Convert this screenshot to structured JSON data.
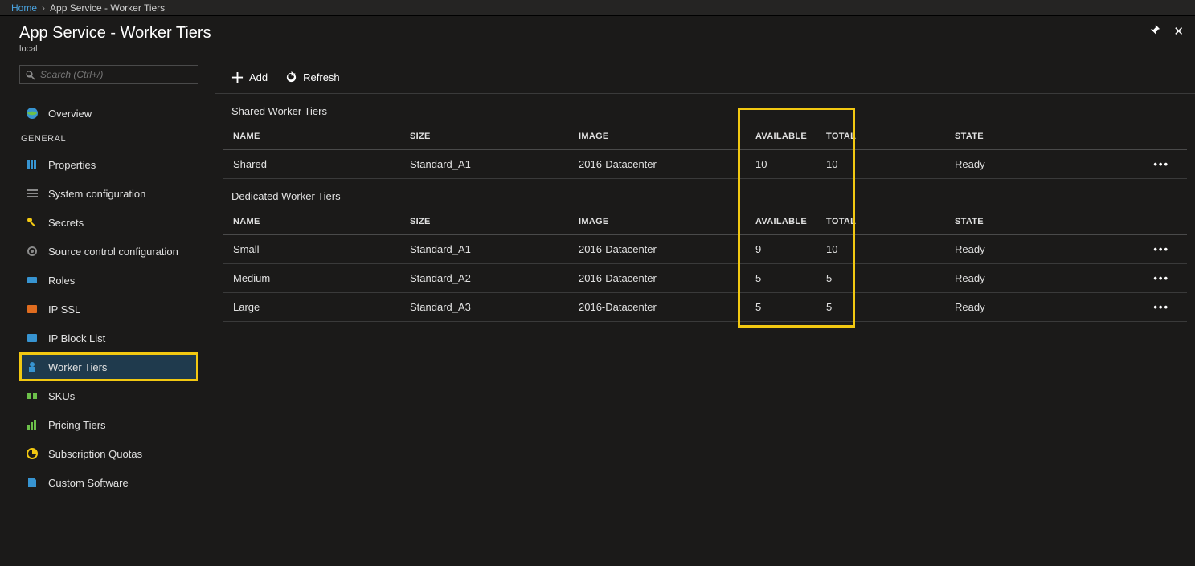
{
  "breadcrumb": {
    "home": "Home",
    "current": "App Service - Worker Tiers"
  },
  "header": {
    "title": "App Service - Worker Tiers",
    "subtitle": "local"
  },
  "search": {
    "placeholder": "Search (Ctrl+/)"
  },
  "nav": {
    "overview": "Overview",
    "general_label": "GENERAL",
    "items": [
      {
        "label": "Properties"
      },
      {
        "label": "System configuration"
      },
      {
        "label": "Secrets"
      },
      {
        "label": "Source control configuration"
      },
      {
        "label": "Roles"
      },
      {
        "label": "IP SSL"
      },
      {
        "label": "IP Block List"
      },
      {
        "label": "Worker Tiers"
      },
      {
        "label": "SKUs"
      },
      {
        "label": "Pricing Tiers"
      },
      {
        "label": "Subscription Quotas"
      },
      {
        "label": "Custom Software"
      }
    ]
  },
  "toolbar": {
    "add": "Add",
    "refresh": "Refresh"
  },
  "columns": {
    "name": "NAME",
    "size": "SIZE",
    "image": "IMAGE",
    "available": "AVAILABLE",
    "total": "TOTAL",
    "state": "STATE"
  },
  "shared": {
    "title": "Shared Worker Tiers",
    "rows": [
      {
        "name": "Shared",
        "size": "Standard_A1",
        "image": "2016-Datacenter",
        "available": "10",
        "total": "10",
        "state": "Ready"
      }
    ]
  },
  "dedicated": {
    "title": "Dedicated Worker Tiers",
    "rows": [
      {
        "name": "Small",
        "size": "Standard_A1",
        "image": "2016-Datacenter",
        "available": "9",
        "total": "10",
        "state": "Ready"
      },
      {
        "name": "Medium",
        "size": "Standard_A2",
        "image": "2016-Datacenter",
        "available": "5",
        "total": "5",
        "state": "Ready"
      },
      {
        "name": "Large",
        "size": "Standard_A3",
        "image": "2016-Datacenter",
        "available": "5",
        "total": "5",
        "state": "Ready"
      }
    ]
  },
  "more": "•••"
}
